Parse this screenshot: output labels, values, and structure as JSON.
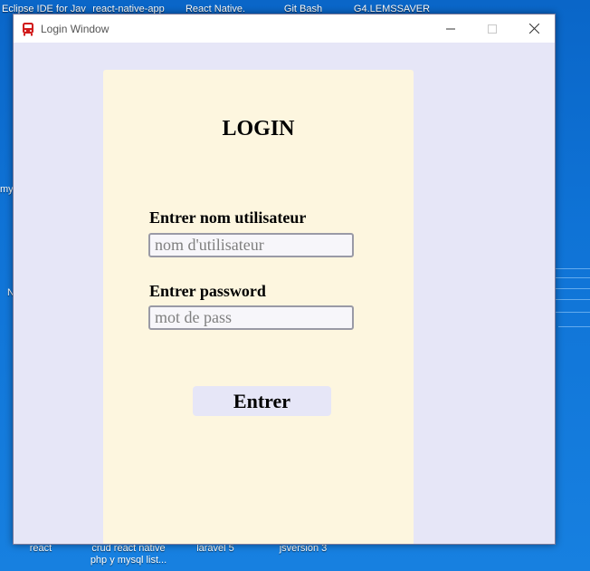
{
  "desktop": {
    "top_icons": [
      "Eclipse IDE for Jav",
      "react-native-app",
      "React Native.",
      "Git Bash",
      "G4.LEMSSAVER"
    ],
    "bottom_icons": [
      {
        "line1": "react",
        "line2": ""
      },
      {
        "line1": "crud react native",
        "line2": "php y mysql list..."
      },
      {
        "line1": "laravel 5",
        "line2": ""
      },
      {
        "line1": "jsversion 3",
        "line2": ""
      }
    ],
    "left_edge_fragments": [
      "my",
      "N"
    ],
    "colors": {
      "background": "#0f73d6"
    }
  },
  "window": {
    "title": "Login Window",
    "app_icon": "bus-icon",
    "controls": {
      "minimize": "minimize-icon",
      "maximize": "maximize-icon",
      "close": "close-icon"
    }
  },
  "form": {
    "title": "LOGIN",
    "username": {
      "label": "Entrer nom utilisateur",
      "value": "",
      "placeholder": "nom d'utilisateur"
    },
    "password": {
      "label": "Entrer password",
      "value": "",
      "placeholder": "mot de pass"
    },
    "submit_label": "Entrer",
    "colors": {
      "card": "#fdf6df",
      "window": "#e6e6f7",
      "button": "#e6e6f7"
    }
  }
}
